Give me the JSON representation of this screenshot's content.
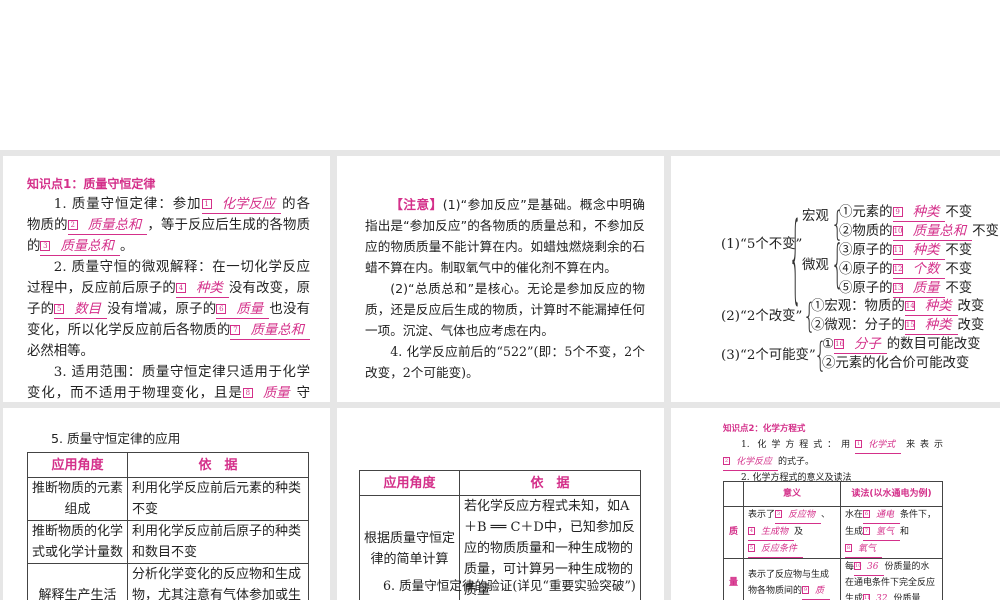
{
  "panel1": {
    "title": "知识点1：质量守恒定律",
    "paras": [
      [
        {
          "t": "1. 质量守恒定律：参加"
        },
        {
          "n": "1",
          "a": "化学反应"
        },
        {
          "t": "的各物质的"
        },
        {
          "n": "2",
          "a": "质量总和"
        },
        {
          "t": "，等于反应后生成的各物质的"
        },
        {
          "n": "3",
          "a": "质量总和"
        },
        {
          "t": "。"
        }
      ],
      [
        {
          "t": "2. 质量守恒的微观解释：在一切化学反应过程中，反应前后原子的"
        },
        {
          "n": "4",
          "a": "种类"
        },
        {
          "t": "没有改变，原子的"
        },
        {
          "n": "5",
          "a": "数目"
        },
        {
          "t": "没有增减，原子的"
        },
        {
          "n": "6",
          "a": "质量"
        },
        {
          "t": "也没有变化，所以化学反应前后各物质的"
        },
        {
          "n": "7",
          "a": "质量总和"
        },
        {
          "t": "必然相等。"
        }
      ],
      [
        {
          "t": "3. 适用范围：质量守恒定律只适用于化学变化，而不适用于物理变化，且是"
        },
        {
          "n": "8",
          "a": "质量"
        },
        {
          "t": "守恒，与体积无关。"
        }
      ]
    ]
  },
  "panel2": {
    "note_label": "【注意】",
    "paras": [
      [
        {
          "t": "(1)“参加反应”是基础。概念中明确指出是“参加反应”的各物质的质量总和，不参加反应的物质质量不能计算在内。如蜡烛燃烧剩余的石蜡不算在内。制取氧气中的催化剂不算在内。"
        }
      ],
      [
        {
          "t": "(2)“总质总和”是核心。无论是参加反应的物质，还是反应后生成的物质，计算时不能漏掉任何一项。沉淀、气体也应考虑在内。"
        }
      ],
      [
        {
          "t": "4. 化学反应前后的“522”(即：5个不变，2个改变，2个可能变)。"
        }
      ]
    ]
  },
  "panel3": {
    "g1_label": "(1)“5个不变”",
    "macro": "宏观",
    "micro": "微观",
    "g1": [
      [
        {
          "t": "①元素的"
        },
        {
          "n": "9",
          "a": "种类"
        },
        {
          "t": "不变"
        }
      ],
      [
        {
          "t": "②物质的"
        },
        {
          "n": "10",
          "a": "质量总和"
        },
        {
          "t": "不变"
        }
      ],
      [
        {
          "t": "③原子的"
        },
        {
          "n": "11",
          "a": "种类"
        },
        {
          "t": "不变"
        }
      ],
      [
        {
          "t": "④原子的"
        },
        {
          "n": "12",
          "a": "个数"
        },
        {
          "t": "不变"
        }
      ],
      [
        {
          "t": "⑤原子的"
        },
        {
          "n": "13",
          "a": "质量"
        },
        {
          "t": "不变"
        }
      ]
    ],
    "g2_label": "(2)“2个改变”",
    "g2": [
      [
        {
          "t": "①宏观：物质的"
        },
        {
          "n": "14",
          "a": "种类"
        },
        {
          "t": "改变"
        }
      ],
      [
        {
          "t": "②微观：分子的"
        },
        {
          "n": "15",
          "a": "种类"
        },
        {
          "t": "改变"
        }
      ]
    ],
    "g3_label": "(3)“2个可能变”",
    "g3": [
      [
        {
          "t": "①"
        },
        {
          "n": "16",
          "a": "分子"
        },
        {
          "t": "的数目可能改变"
        }
      ],
      [
        {
          "t": "②元素的化合价可能改变"
        }
      ]
    ]
  },
  "panel4": {
    "heading": "5. 质量守恒定律的应用",
    "headers": [
      "应用角度",
      "依　据"
    ],
    "rows": [
      [
        "推断物质的元素组成",
        "利用化学反应前后元素的种类不变"
      ],
      [
        "推断物质的化学式或化学计量数",
        "利用化学反应前后原子的种类和数目不变"
      ],
      [
        "解释生产生活",
        "分析化学变化的反应物和生成物，尤其注意有气体参加或生成"
      ]
    ]
  },
  "panel5": {
    "headers": [
      "应用角度",
      "依　据"
    ],
    "rows": [
      [
        "根据质量守恒定律的简单计算",
        "若化学反应方程式未知，如A＋B ══ C＋D中，已知参加反应的物质质量和一种生成物的质量，可计算另一种生成物的质量"
      ]
    ],
    "footer": "6. 质量守恒定律的验证(详见“重要实验突破”)"
  },
  "panel6": {
    "title": "知识点2：化学方程式",
    "paras": [
      [
        {
          "t": "1. 化学方程式：用"
        },
        {
          "n": "1",
          "a": "化学式"
        },
        {
          "t": "来表示"
        },
        {
          "n": "2",
          "a": "化学反应"
        },
        {
          "t": "的式子。"
        }
      ],
      [
        {
          "t": "2. 化学方程式的意义及读法"
        }
      ]
    ],
    "headers": [
      "",
      "意义",
      "读法(以水通电为例)"
    ],
    "row1_label": "质",
    "row1_meaning": [
      {
        "t": "表示了"
      },
      {
        "n": "3",
        "a": "反应物"
      },
      {
        "t": "、"
      },
      {
        "n": "4",
        "a": "生成物"
      },
      {
        "t": "及"
      },
      {
        "n": "5",
        "a": "反应条件"
      }
    ],
    "row1_reading": [
      {
        "t": "水在"
      },
      {
        "n": "6",
        "a": "通电"
      },
      {
        "t": "条件下，生成"
      },
      {
        "n": "7",
        "a": "氢气"
      },
      {
        "t": "和"
      },
      {
        "n": "8",
        "a": "氧气"
      }
    ],
    "row2_label": "量",
    "row2_meaning": [
      {
        "t": "表示了反应物与生成物各物质间的"
      },
      {
        "n": "9",
        "a": "质"
      }
    ],
    "row2_reading": [
      {
        "t": "每"
      },
      {
        "n": "10",
        "a": "36"
      },
      {
        "t": "份质量的水在通电条件下完全反应生成"
      },
      {
        "n": "11",
        "a": "32"
      },
      {
        "t": "份质量"
      }
    ]
  }
}
